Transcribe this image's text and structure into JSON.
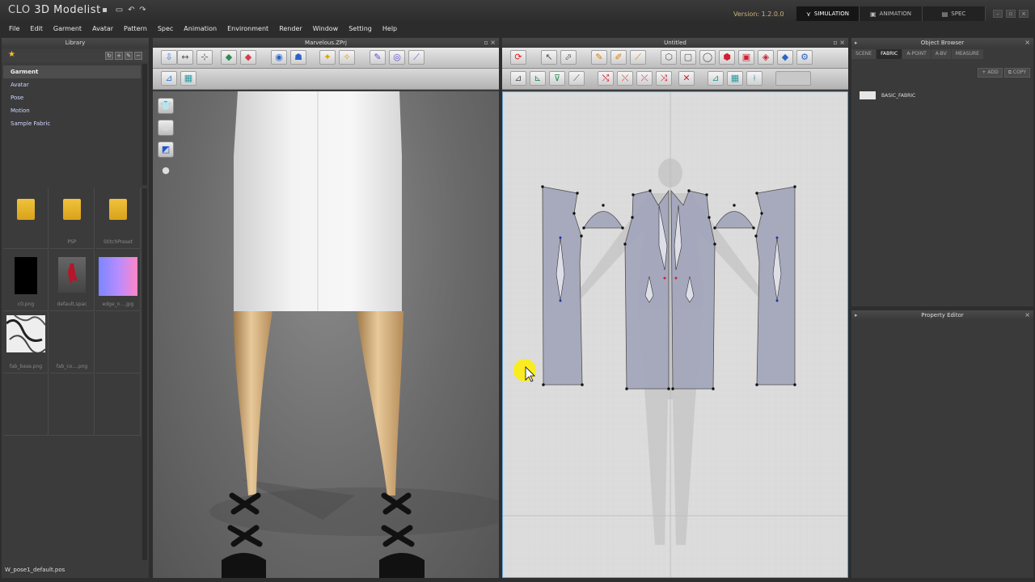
{
  "app": {
    "logo_brand": "ϹLO",
    "logo_name": "3D Modelist",
    "version": "Version: 1.2.0.0"
  },
  "modes": [
    {
      "label": "SIMULATION",
      "icon": "⋎"
    },
    {
      "label": "ANIMATION",
      "icon": "▣"
    },
    {
      "label": "SPEC",
      "icon": "▤"
    }
  ],
  "menu": [
    "File",
    "Edit",
    "Garment",
    "Avatar",
    "Pattern",
    "Spec",
    "Animation",
    "Environment",
    "Render",
    "Window",
    "Setting",
    "Help"
  ],
  "library": {
    "title": "Library",
    "tree": [
      "Garment",
      "Avatar",
      "Pose",
      "Motion",
      "Sample Fabric"
    ],
    "thumbs": [
      {
        "label": "",
        "kind": "folder"
      },
      {
        "label": "PSP",
        "kind": "folder"
      },
      {
        "label": "StitchPreset",
        "kind": "folder"
      },
      {
        "label": "c0.png",
        "kind": "black"
      },
      {
        "label": "default.spac",
        "kind": "avatar"
      },
      {
        "label": "edge_n....jpg",
        "kind": "gradient"
      },
      {
        "label": "fab_base.png",
        "kind": "fabric"
      },
      {
        "label": "fab_co....png",
        "kind": "empty"
      }
    ],
    "status_file": "W_pose1_default.pos"
  },
  "view3d": {
    "title": "Marvelous.ZPrj"
  },
  "view2d": {
    "title": "Untitled"
  },
  "object_browser": {
    "title": "Object Browser",
    "tabs": [
      "SCENE",
      "FABRIC",
      "A-POINT",
      "A-BV",
      "MEASURE"
    ],
    "add_label": "ADD",
    "copy_label": "COPY",
    "fabric_name": "BASIC_FABRIC"
  },
  "property_editor": {
    "title": "Property Editor"
  }
}
